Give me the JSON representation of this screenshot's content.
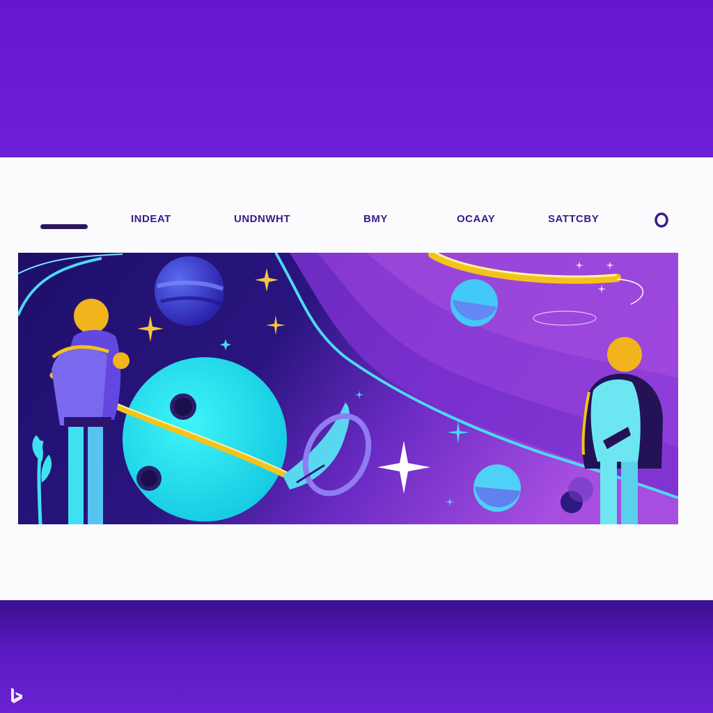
{
  "nav": {
    "links": [
      {
        "label": "INDEAT"
      },
      {
        "label": "UNDNWHT"
      },
      {
        "label": "BMY"
      },
      {
        "label": "OCAAY"
      },
      {
        "label": "SATTCBY"
      }
    ],
    "search_icon": "search-icon",
    "menu_icon": "menu-dash-icon"
  },
  "hero": {
    "illustration": "space-illustration"
  },
  "colors": {
    "band": "#6a1bd1",
    "card": "#fbfbfd",
    "nav_text": "#3b1a8a",
    "hero_dark": "#23127a",
    "hero_violet": "#8a37d6",
    "cyan": "#1ee6f0",
    "gold": "#f2c31a"
  }
}
